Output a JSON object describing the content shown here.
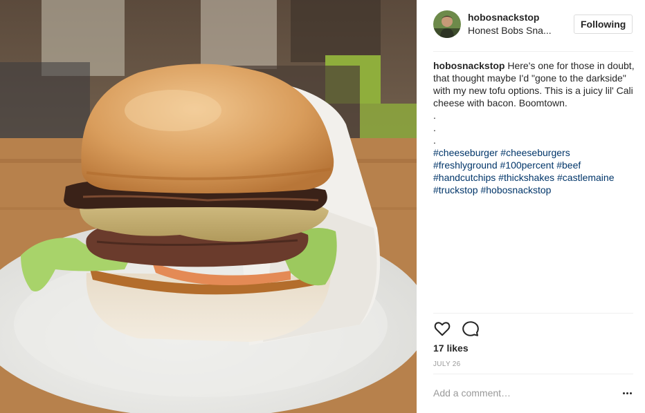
{
  "post": {
    "username": "hobosnackstop",
    "location": "Honest Bobs Sna...",
    "follow_label": "Following",
    "caption": {
      "username": "hobosnackstop",
      "text": "Here's one for those in doubt, that thought maybe I'd \"gone to the darkside\" with my new tofu options. This is a juicy lil' Cali cheese with bacon. Boomtown.",
      "dots": [
        ".",
        ".",
        "."
      ],
      "hashtags_lines": [
        "#cheeseburger #cheeseburgers",
        "#freshlyground #100percent #beef",
        "#handcutchips #thickshakes #castlemaine",
        "#truckstop #hobosnackstop"
      ]
    },
    "likes": "17 likes",
    "date": "JULY 26",
    "comment_placeholder": "Add a comment…"
  },
  "icons": {
    "like": "heart-icon",
    "comment": "comment-bubble-icon",
    "more": "more-options-icon"
  },
  "colors": {
    "text": "#262626",
    "hashtag": "#003569",
    "muted": "#999999",
    "divider": "#efefef"
  }
}
